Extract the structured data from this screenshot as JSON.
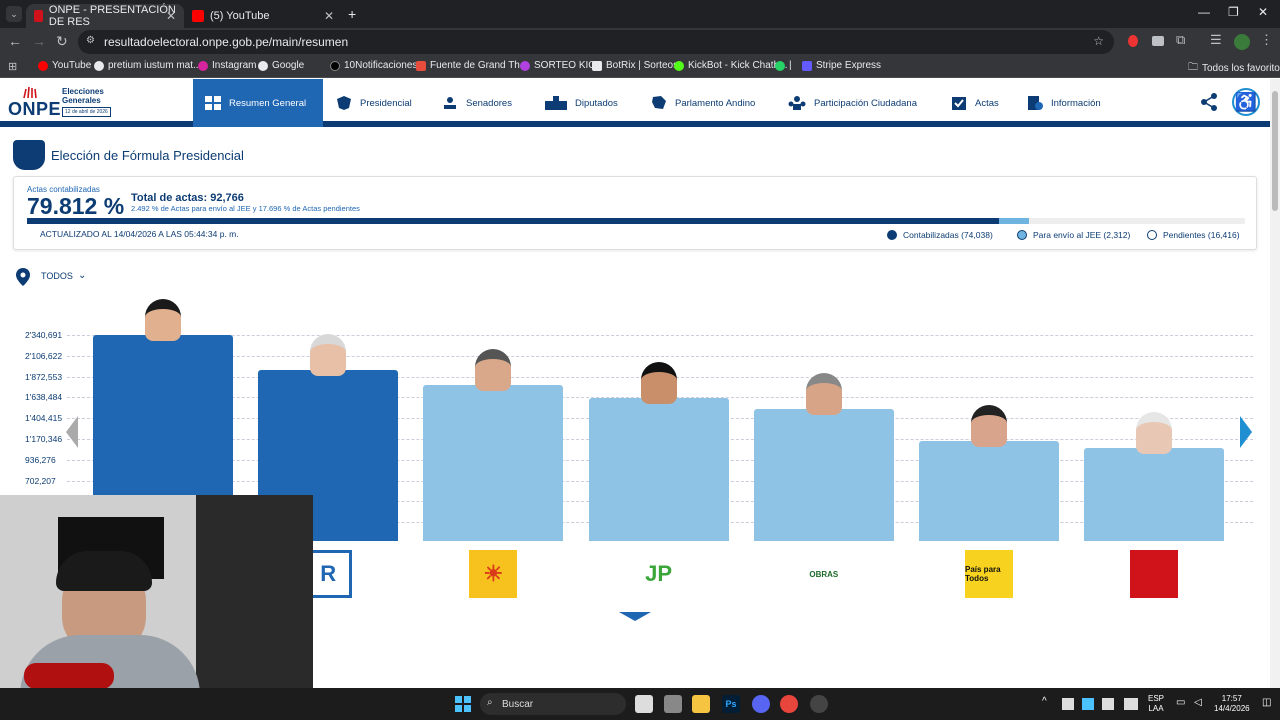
{
  "browser": {
    "tabs": [
      {
        "title": "ONPE - PRESENTACIÓN DE RES",
        "active": true
      },
      {
        "title": "(5) YouTube",
        "active": false
      }
    ],
    "url": "resultadoelectoral.onpe.gob.pe/main/resumen",
    "bookmarks": [
      "YouTube",
      "pretium iustum mat...",
      "Instagram",
      "Google",
      "10Notificaciones",
      "Fuente de Grand Th...",
      "SORTEO KICK",
      "BotRix | Sorteos",
      "KickBot - Kick Chatb...",
      "|",
      "Stripe Express"
    ],
    "all_bookmarks": "Todos los favoritos"
  },
  "header": {
    "logo": "ONPE",
    "event_line1": "Elecciones",
    "event_line2": "Generales",
    "event_date": "12 de abril de 2026",
    "nav": [
      {
        "label": "Resumen General",
        "active": true
      },
      {
        "label": "Presidencial"
      },
      {
        "label": "Senadores"
      },
      {
        "label": "Diputados"
      },
      {
        "label": "Parlamento Andino"
      },
      {
        "label": "Participación Ciudadana"
      },
      {
        "label": "Actas"
      },
      {
        "label": "Información"
      }
    ]
  },
  "page": {
    "title": "Elección de Fórmula Presidencial",
    "actas_label": "Actas contabilizadas",
    "actas_pct": "79.812 %",
    "total_actas": "Total de actas: 92,766",
    "subtotal": "2.492 % de Actas para envío al JEE y 17.696 % de Actas pendientes",
    "updated": "ACTUALIZADO AL 14/04/2026 A LAS 05:44:34 p. m.",
    "progress": {
      "contabilizadas_pct": 79.812,
      "jee_pct": 2.492
    },
    "legend": [
      {
        "label": "Contabilizadas (74,038)",
        "color": "#0c3c73"
      },
      {
        "label": "Para envío al JEE (2,312)",
        "color": "#6fb3e0"
      },
      {
        "label": "Pendientes (16,416)",
        "color": "#ffffff"
      }
    ],
    "filter": "TODOS"
  },
  "chart_data": {
    "type": "bar",
    "yticks": [
      "2'340,691",
      "2'106,622",
      "1'872,553",
      "1'638,484",
      "1'404,415",
      "1'170,346",
      "936,276",
      "702,207"
    ],
    "ytick_values": [
      2340691,
      2106622,
      1872553,
      1638484,
      1404415,
      1170346,
      936276,
      702207
    ],
    "values": [
      2340691,
      1950000,
      1775000,
      1630000,
      1510000,
      1150000,
      1070000
    ],
    "colors": [
      "#1f66b3",
      "#1f66b3",
      "#8ec3e6",
      "#8ec3e6",
      "#8ec3e6",
      "#8ec3e6",
      "#8ec3e6"
    ],
    "party_logos": [
      {
        "text": "",
        "bg": "#ffffff",
        "fg": "#ffffff"
      },
      {
        "text": "R",
        "bg": "#ffffff",
        "fg": "#1f66b3"
      },
      {
        "text": "☀",
        "bg": "#f7c11e",
        "fg": "#d93a1a"
      },
      {
        "text": "JP",
        "bg": "#ffffff",
        "fg": "#3aa63a"
      },
      {
        "text": "OBRAS",
        "bg": "#ffffff",
        "fg": "#1f6b2a"
      },
      {
        "text": "País para Todos",
        "bg": "#f7d21e",
        "fg": "#111111"
      },
      {
        "text": "",
        "bg": "#d0121b",
        "fg": "#ffffff"
      }
    ]
  },
  "taskbar": {
    "search": "Buscar",
    "lang1": "ESP",
    "lang2": "LAA",
    "time": "17:57",
    "date": "14/4/2026"
  }
}
